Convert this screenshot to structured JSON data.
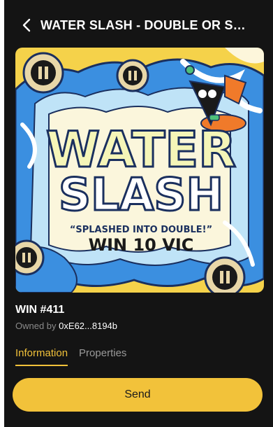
{
  "header": {
    "title": "WATER SLASH - DOUBLE OR SO...",
    "back_icon": "chevron-left-icon"
  },
  "artwork": {
    "headline_line1": "WATER",
    "headline_line2": "SLASH",
    "quote": "“SPLASHED INTO DOUBLE!”",
    "prize": "WIN 10 VIC",
    "colors": {
      "blue": "#3b8fe0",
      "yellow": "#f5d24a",
      "cream": "#fbf6dc",
      "outline": "#1a2f5e"
    }
  },
  "nft": {
    "name": "WIN #411",
    "owner_label": "Owned by",
    "owner_address": "0xE62...8194b"
  },
  "tabs": [
    {
      "label": "Information",
      "active": true
    },
    {
      "label": "Properties",
      "active": false
    }
  ],
  "actions": {
    "send_label": "Send"
  },
  "theme": {
    "accent": "#f2c23a",
    "background": "#141414"
  }
}
